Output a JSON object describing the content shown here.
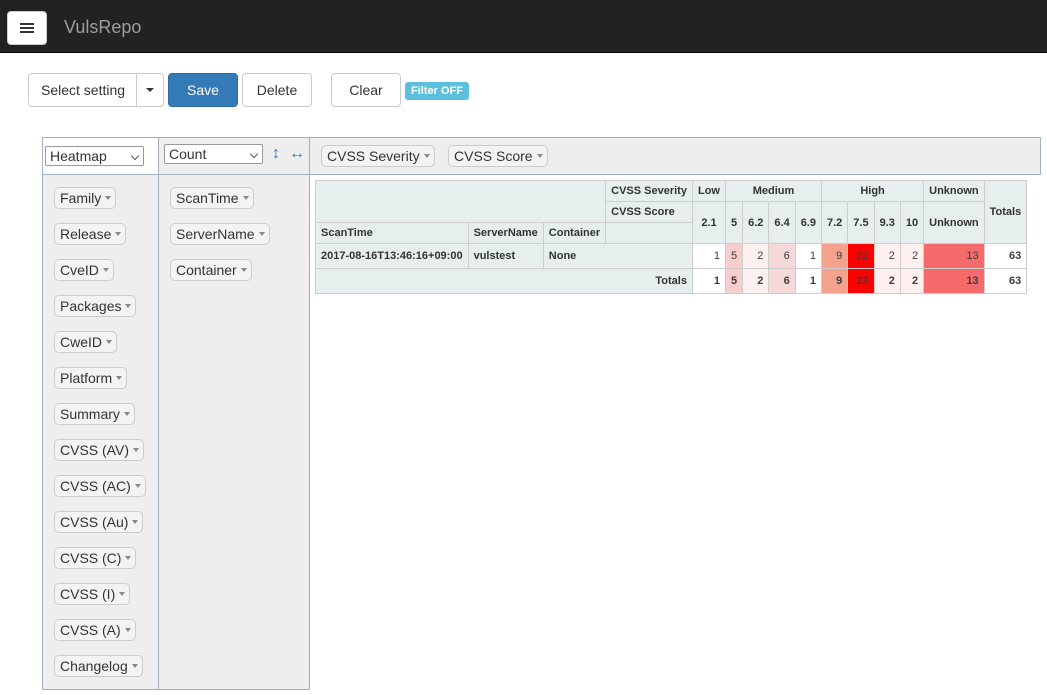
{
  "navbar": {
    "brand": "VulsRepo",
    "menu_icon": "hamburger-menu-icon"
  },
  "toolbar": {
    "select_setting": "Select setting",
    "save": "Save",
    "delete": "Delete",
    "clear": "Clear",
    "filter_badge": "Filter OFF"
  },
  "pivot": {
    "renderer": "Heatmap",
    "aggregator": "Count",
    "column_attrs": [
      "CVSS Severity",
      "CVSS Score"
    ],
    "row_attrs": [
      "ScanTime",
      "ServerName",
      "Container"
    ],
    "unused_attrs": [
      "Family",
      "Release",
      "CveID",
      "Packages",
      "CweID",
      "Platform",
      "Summary",
      "CVSS (AV)",
      "CVSS (AC)",
      "CVSS (Au)",
      "CVSS (C)",
      "CVSS (I)",
      "CVSS (A)",
      "Changelog"
    ]
  },
  "table": {
    "col_attr_labels": [
      "CVSS Severity",
      "CVSS Score"
    ],
    "row_attr_labels": [
      "ScanTime",
      "ServerName",
      "Container"
    ],
    "severity_groups": [
      {
        "label": "Low",
        "span": 1
      },
      {
        "label": "Medium",
        "span": 4
      },
      {
        "label": "High",
        "span": 4
      },
      {
        "label": "Unknown",
        "span": 1
      }
    ],
    "scores": [
      "2.1",
      "5",
      "6.2",
      "6.4",
      "6.9",
      "7.2",
      "7.5",
      "9.3",
      "10",
      "Unknown"
    ],
    "totals_label": "Totals",
    "rows": [
      {
        "scan_time": "2017-08-16T13:46:16+09:00",
        "server": "vulstest",
        "container": "None",
        "values": [
          1,
          5,
          2,
          6,
          1,
          9,
          22,
          2,
          2,
          13
        ],
        "total": 63
      }
    ],
    "col_totals": [
      1,
      5,
      2,
      6,
      1,
      9,
      22,
      2,
      2,
      13
    ],
    "grand_total": 63,
    "heat_colors": {
      "1": "#ffffff",
      "2": "#fff0f0",
      "5": "#f7cdcd",
      "6": "#f7d8d8",
      "9": "#f4a28e",
      "13": "#f56b6b",
      "22": "#ff0000"
    }
  }
}
